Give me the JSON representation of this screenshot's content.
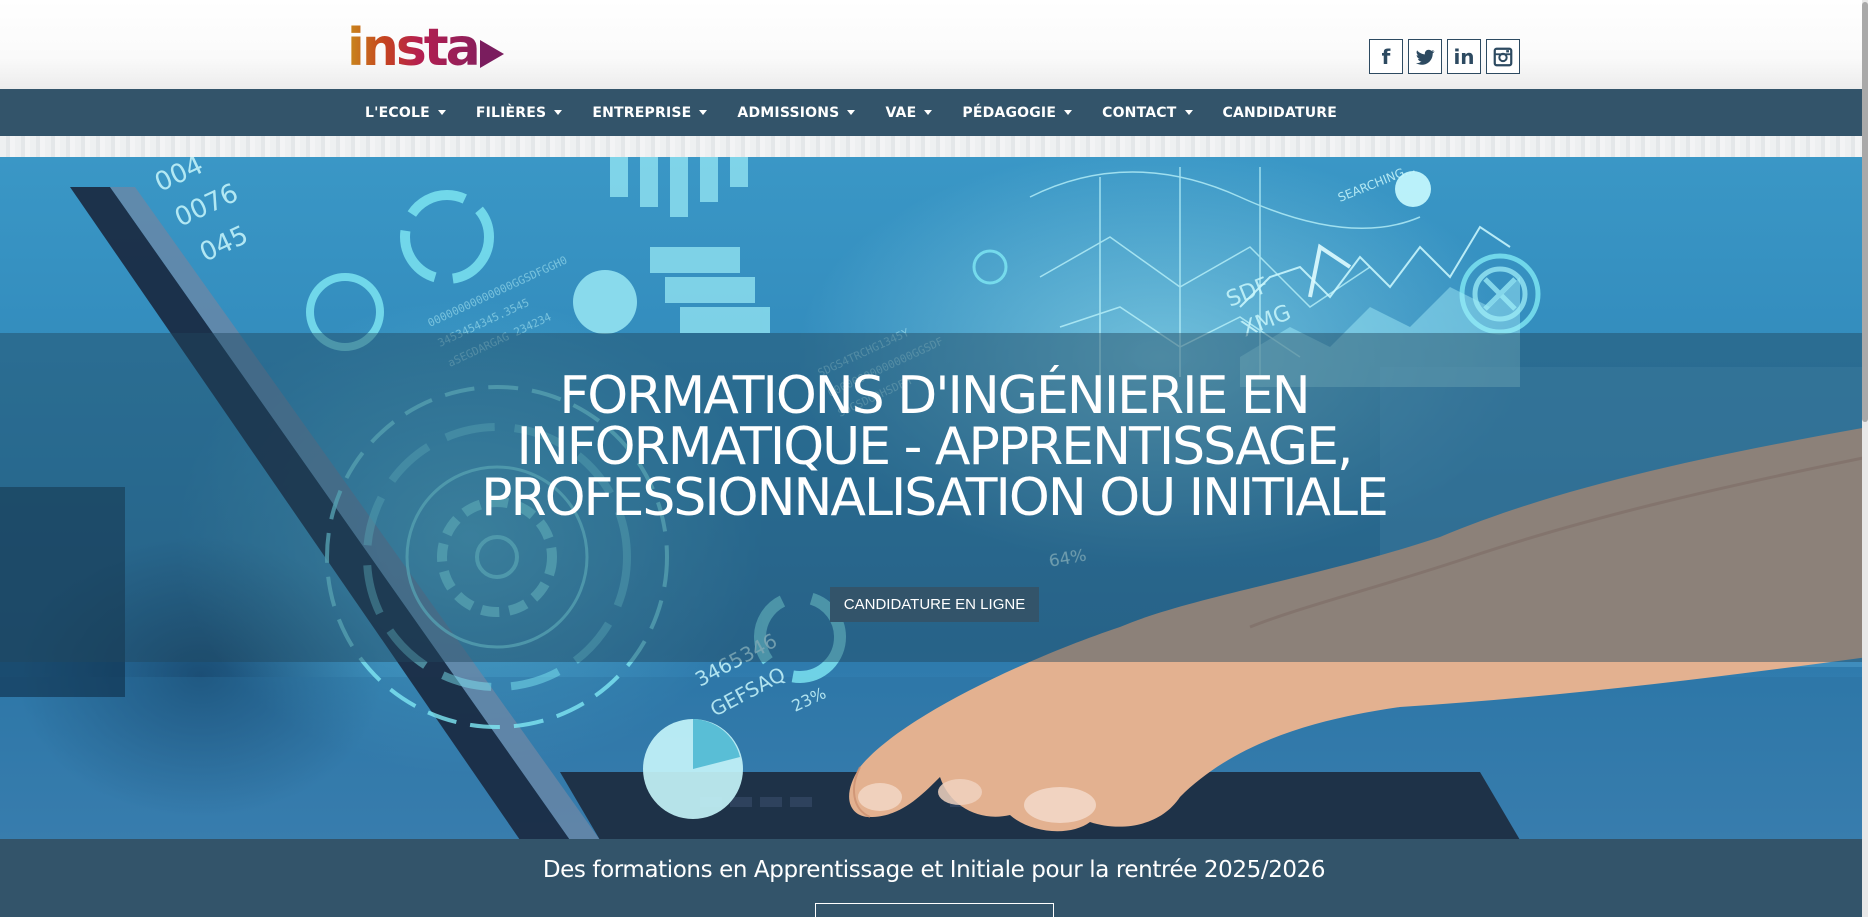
{
  "header": {
    "logo_text": "insta",
    "social": [
      {
        "icon": "facebook-icon",
        "glyph": "f"
      },
      {
        "icon": "twitter-icon",
        "glyph": ""
      },
      {
        "icon": "linkedin-icon",
        "glyph": "in"
      },
      {
        "icon": "instagram-icon",
        "glyph": ""
      }
    ]
  },
  "nav": {
    "items": [
      {
        "label": "L'ECOLE",
        "dropdown": true
      },
      {
        "label": "FILIÈRES",
        "dropdown": true
      },
      {
        "label": "ENTREPRISE",
        "dropdown": true
      },
      {
        "label": "ADMISSIONS",
        "dropdown": true
      },
      {
        "label": "VAE",
        "dropdown": true
      },
      {
        "label": "PÉDAGOGIE",
        "dropdown": true
      },
      {
        "label": "CONTACT",
        "dropdown": true
      },
      {
        "label": "CANDIDATURE",
        "dropdown": false
      }
    ]
  },
  "hero": {
    "title": "FORMATIONS D'INGÉNIERIE EN INFORMATIQUE - APPRENTISSAGE, PROFESSIONNALISATION OU INITIALE",
    "cta_label": "CANDIDATURE EN LIGNE",
    "image_texts": [
      "004",
      "0076",
      "045",
      "SDF",
      "XMG",
      "SEARCHING...",
      "23%",
      "64%",
      "3465346",
      "GEFSAQ"
    ]
  },
  "band": {
    "text": "Des formations en Apprentissage et Initiale pour la rentrée 2025/2026"
  },
  "colors": {
    "nav_bg": "#33546a",
    "accent": "#b21f4c",
    "hero_blue": "#2f86b8"
  }
}
